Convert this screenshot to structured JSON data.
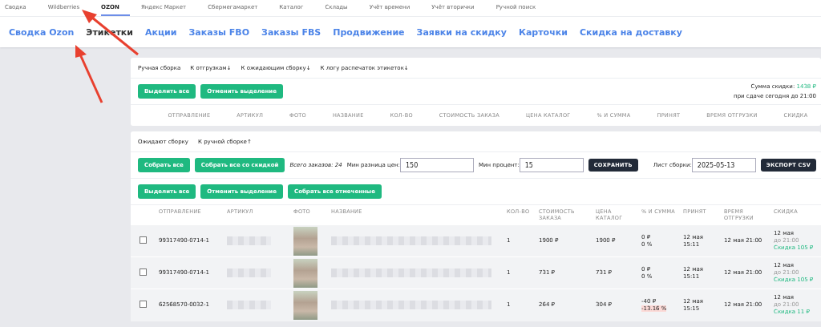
{
  "top_nav": [
    {
      "label": "Сводка",
      "selected": false
    },
    {
      "label": "Wildberries",
      "selected": false
    },
    {
      "label": "OZON",
      "selected": true
    },
    {
      "label": "Яндекс Маркет",
      "selected": false
    },
    {
      "label": "Сбермегамаркет",
      "selected": false
    },
    {
      "label": "Каталог",
      "selected": false
    },
    {
      "label": "Склады",
      "selected": false
    },
    {
      "label": "Учёт времени",
      "selected": false
    },
    {
      "label": "Учёт вторички",
      "selected": false
    },
    {
      "label": "Ручной поиск",
      "selected": false
    }
  ],
  "sub_nav": [
    {
      "label": "Сводка Ozon",
      "selected": false
    },
    {
      "label": "Этикетки",
      "selected": true
    },
    {
      "label": "Акции",
      "selected": false
    },
    {
      "label": "Заказы FBO",
      "selected": false
    },
    {
      "label": "Заказы FBS",
      "selected": false
    },
    {
      "label": "Продвижение",
      "selected": false
    },
    {
      "label": "Заявки на скидку",
      "selected": false
    },
    {
      "label": "Карточки",
      "selected": false
    },
    {
      "label": "Скидка на доставку",
      "selected": false
    }
  ],
  "manual_card": {
    "links": [
      "Ручная сборка",
      "К отгрузкам↓",
      "К ожидающим сборку↓",
      "К логу распечаток этикеток↓"
    ],
    "buttons": [
      "Выделить все",
      "Отменить выделение"
    ],
    "discount_label": "Сумма скидки:",
    "discount_value": "1438 ₽",
    "discount_note": "при сдаче сегодня до 21:00",
    "columns": [
      "ОТПРАВЛЕНИЕ",
      "АРТИКУЛ",
      "ФОТО",
      "НАЗВАНИЕ",
      "КОЛ-ВО",
      "СТОИМОСТЬ ЗАКАЗА",
      "ЦЕНА КАТАЛОГ",
      "% И СУММА",
      "ПРИНЯТ",
      "ВРЕМЯ ОТГРУЗКИ",
      "СКИДКА"
    ]
  },
  "waiting_card": {
    "links": [
      "Ожидают сборку",
      "К ручной сборке↑"
    ],
    "collect_buttons": [
      "Собрать все",
      "Собрать все со скидкой"
    ],
    "total_orders": "Всего заказов: 24",
    "min_diff_label": "Мин разница цен:",
    "min_diff_value": "150",
    "min_percent_label": "Мин процент:",
    "min_percent_value": "15",
    "save_button": "СОХРАНИТЬ",
    "sheet_label": "Лист сборки:",
    "sheet_value": "2025-05-13",
    "export_button": "ЭКСПОРТ CSV",
    "select_buttons": [
      "Выделить все",
      "Отменить выделение",
      "Собрать все отмеченные"
    ],
    "columns": [
      "ОТПРАВЛЕНИЕ",
      "АРТИКУЛ",
      "ФОТО",
      "НАЗВАНИЕ",
      "КОЛ-ВО",
      "СТОИМОСТЬ ЗАКАЗА",
      "ЦЕНА КАТАЛОГ",
      "% И СУММА",
      "ПРИНЯТ",
      "ВРЕМЯ ОТГРУЗКИ",
      "СКИДКА"
    ],
    "rows": [
      {
        "checked": false,
        "shipment": "99317490-0714-1",
        "qty": "1",
        "order_cost": "1900 ₽",
        "catalog_price": "1900 ₽",
        "diff_sum": "0 ₽",
        "diff_percent": "0 %",
        "negative": false,
        "accepted_date": "12 мая",
        "accepted_time": "15:11",
        "ship_time": "12 мая 21:00",
        "discount_date": "12 мая",
        "discount_until": "до 21:00",
        "discount_amount": "Скидка 105 ₽"
      },
      {
        "checked": false,
        "shipment": "99317490-0714-1",
        "qty": "1",
        "order_cost": "731 ₽",
        "catalog_price": "731 ₽",
        "diff_sum": "0 ₽",
        "diff_percent": "0 %",
        "negative": false,
        "accepted_date": "12 мая",
        "accepted_time": "15:11",
        "ship_time": "12 мая 21:00",
        "discount_date": "12 мая",
        "discount_until": "до 21:00",
        "discount_amount": "Скидка 105 ₽"
      },
      {
        "checked": false,
        "shipment": "62568570-0032-1",
        "qty": "1",
        "order_cost": "264 ₽",
        "catalog_price": "304 ₽",
        "diff_sum": "-40 ₽",
        "diff_percent": "-13.16 %",
        "negative": true,
        "accepted_date": "12 мая",
        "accepted_time": "15:15",
        "ship_time": "12 мая 21:00",
        "discount_date": "12 мая",
        "discount_until": "до 21:00",
        "discount_amount": "Скидка 11 ₽"
      }
    ]
  }
}
